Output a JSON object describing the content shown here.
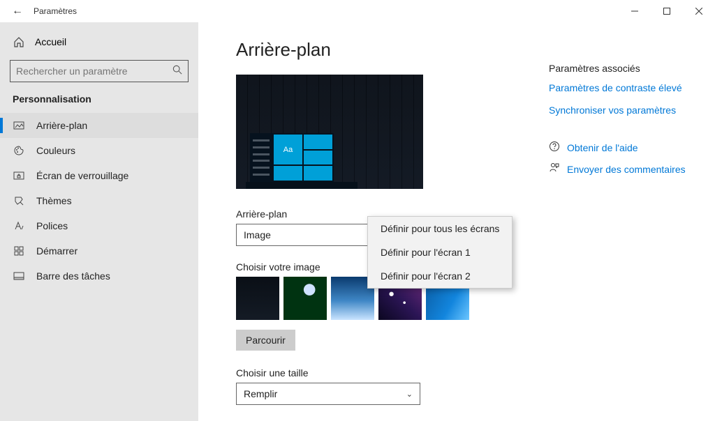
{
  "window": {
    "title": "Paramètres"
  },
  "sidebar": {
    "home": "Accueil",
    "search_placeholder": "Rechercher un paramètre",
    "group": "Personnalisation",
    "items": [
      {
        "label": "Arrière-plan"
      },
      {
        "label": "Couleurs"
      },
      {
        "label": "Écran de verrouillage"
      },
      {
        "label": "Thèmes"
      },
      {
        "label": "Polices"
      },
      {
        "label": "Démarrer"
      },
      {
        "label": "Barre des tâches"
      }
    ]
  },
  "main": {
    "heading": "Arrière-plan",
    "preview_tile_text": "Aa",
    "bg_label": "Arrière-plan",
    "bg_value": "Image",
    "choose_image_label": "Choisir votre image",
    "browse": "Parcourir",
    "fit_label": "Choisir une taille",
    "fit_value": "Remplir"
  },
  "context_menu": {
    "items": [
      "Définir pour tous les écrans",
      "Définir pour l'écran 1",
      "Définir pour l'écran 2"
    ]
  },
  "related": {
    "heading": "Paramètres associés",
    "links": [
      "Paramètres de contraste élevé",
      "Synchroniser vos paramètres"
    ],
    "help": "Obtenir de l'aide",
    "feedback": "Envoyer des commentaires"
  }
}
